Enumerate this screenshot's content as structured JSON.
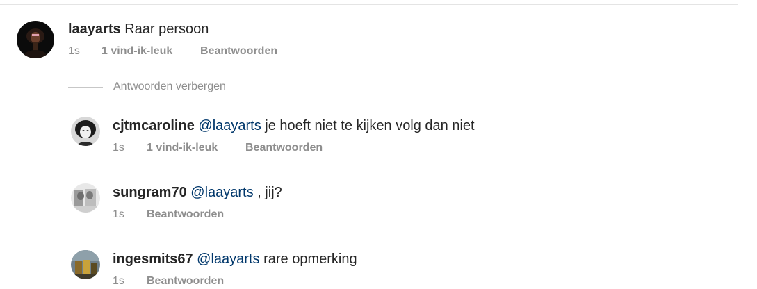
{
  "main_comment": {
    "username": "laayarts",
    "text": "Raar persoon",
    "time": "1s",
    "likes": "1 vind-ik-leuk",
    "reply": "Beantwoorden"
  },
  "hide_replies_label": "Antwoorden verbergen",
  "replies": [
    {
      "username": "cjtmcaroline",
      "mention": "@laayarts",
      "text": "je hoeft niet te kijken volg dan niet",
      "time": "1s",
      "likes": "1 vind-ik-leuk",
      "reply": "Beantwoorden"
    },
    {
      "username": "sungram70",
      "mention": "@laayarts",
      "text": ", jij?",
      "time": "1s",
      "reply": "Beantwoorden"
    },
    {
      "username": "ingesmits67",
      "mention": "@laayarts",
      "text": "rare opmerking",
      "time": "1s",
      "reply": "Beantwoorden"
    }
  ]
}
